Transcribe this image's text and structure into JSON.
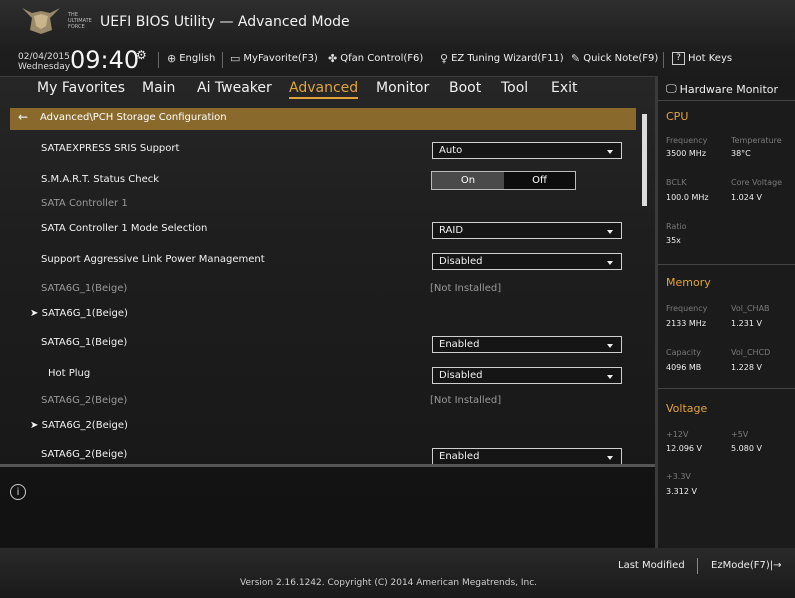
{
  "header": {
    "logo_text": "THE ULTIMATE FORCE",
    "title": "UEFI BIOS Utility — Advanced Mode",
    "date": "02/04/2015",
    "day": "Wednesday",
    "time": "09:40",
    "tools": {
      "language": "English",
      "favorite": "MyFavorite(F3)",
      "qfan": "Qfan Control(F6)",
      "ez_tuning": "EZ Tuning Wizard(F11)",
      "quick_note": "Quick Note(F9)",
      "hot_keys": "Hot Keys"
    }
  },
  "tabs": [
    "My Favorites",
    "Main",
    "Ai Tweaker",
    "Advanced",
    "Monitor",
    "Boot",
    "Tool",
    "Exit"
  ],
  "active_tab": "Advanced",
  "breadcrumb": "Advanced\\PCH Storage Configuration",
  "rows": [
    {
      "label": "SATAEXPRESS SRIS Support",
      "value": "Auto"
    },
    {
      "label": "S.M.A.R.T. Status Check",
      "on": "On",
      "off": "Off",
      "selected": "On"
    },
    {
      "label": "SATA Controller 1"
    },
    {
      "label": "SATA Controller 1 Mode Selection",
      "value": "RAID"
    },
    {
      "label": "Support Aggressive Link Power Management",
      "value": "Disabled"
    },
    {
      "label": "SATA6G_1(Beige)",
      "value": "[Not Installed]"
    },
    {
      "label": "SATA6G_1(Beige)"
    },
    {
      "label": "SATA6G_1(Beige)",
      "value": "Enabled"
    },
    {
      "label": "Hot Plug",
      "value": "Disabled"
    },
    {
      "label": "SATA6G_2(Beige)",
      "value": "[Not Installed]"
    },
    {
      "label": "SATA6G_2(Beige)"
    },
    {
      "label": "SATA6G_2(Beige)",
      "value": "Enabled"
    }
  ],
  "hardware_monitor": {
    "title": "Hardware Monitor",
    "cpu": {
      "heading": "CPU",
      "frequency_label": "Frequency",
      "frequency": "3500 MHz",
      "temperature_label": "Temperature",
      "temperature": "38°C",
      "bclk_label": "BCLK",
      "bclk": "100.0 MHz",
      "core_voltage_label": "Core Voltage",
      "core_voltage": "1.024 V",
      "ratio_label": "Ratio",
      "ratio": "35x"
    },
    "memory": {
      "heading": "Memory",
      "frequency_label": "Frequency",
      "frequency": "2133 MHz",
      "vol_chab_label": "Vol_CHAB",
      "vol_chab": "1.231 V",
      "capacity_label": "Capacity",
      "capacity": "4096 MB",
      "vol_chcd_label": "Vol_CHCD",
      "vol_chcd": "1.228 V"
    },
    "voltage": {
      "heading": "Voltage",
      "v12_label": "+12V",
      "v12": "12.096 V",
      "v5_label": "+5V",
      "v5": "5.080 V",
      "v33_label": "+3.3V",
      "v33": "3.312 V"
    }
  },
  "footer": {
    "version": "Version 2.16.1242. Copyright (C) 2014 American Megatrends, Inc.",
    "last_modified": "Last Modified",
    "ezmode": "EzMode(F7)|→"
  },
  "colors": {
    "accent": "#e3a33c",
    "breadcrumb_bg": "#8a6a2c"
  }
}
